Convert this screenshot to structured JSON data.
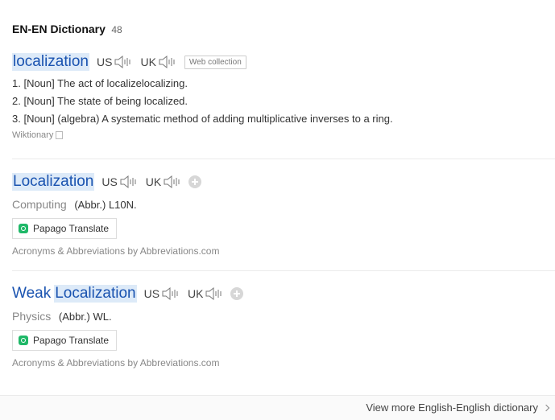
{
  "header": {
    "title": "EN-EN Dictionary",
    "count": "48"
  },
  "entries": [
    {
      "headword_parts": [
        "localization"
      ],
      "us": "US",
      "uk": "UK",
      "tag": "Web collection",
      "defs": [
        "1. [Noun] The act of localizelocalizing.",
        "2. [Noun] The state of being localized.",
        "3. [Noun] (algebra) A systematic method of adding multiplicative inverses to a ring."
      ],
      "source": "Wiktionary"
    },
    {
      "headword_parts": [
        "Localization"
      ],
      "us": "US",
      "uk": "UK",
      "domain": "Computing",
      "abbr": "(Abbr.) L10N.",
      "papago": "Papago Translate",
      "source": "Acronyms & Abbreviations by Abbreviations.com"
    },
    {
      "headword_parts": [
        "Weak",
        "Localization"
      ],
      "us": "US",
      "uk": "UK",
      "domain": "Physics",
      "abbr": "(Abbr.) WL.",
      "papago": "Papago Translate",
      "source": "Acronyms & Abbreviations by Abbreviations.com"
    }
  ],
  "footer": {
    "more": "View more English-English dictionary"
  }
}
